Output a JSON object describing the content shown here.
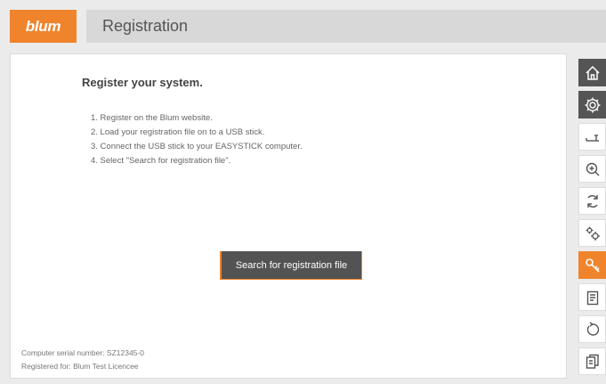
{
  "header": {
    "logo": "blum",
    "title": "Registration"
  },
  "main": {
    "heading": "Register your system.",
    "steps": [
      "1. Register on the Blum website.",
      "2. Load your registration file on to a USB stick.",
      "3. Connect the USB stick to your EASYSTICK computer.",
      "4. Select \"Search for registration file\"."
    ],
    "button_label": "Search for registration file",
    "footer": {
      "serial": "Computer serial number: SZ12345-0",
      "registered": "Registered for: Blum Test Licencee"
    }
  },
  "sidebar": {
    "items": [
      {
        "icon": "home-icon",
        "style": "dark"
      },
      {
        "icon": "settings-icon",
        "style": "dark"
      },
      {
        "icon": "drill-icon",
        "style": "light"
      },
      {
        "icon": "zoom-icon",
        "style": "light"
      },
      {
        "icon": "sync-icon",
        "style": "light"
      },
      {
        "icon": "gears-icon",
        "style": "light"
      },
      {
        "icon": "key-icon",
        "style": "active"
      },
      {
        "icon": "clipboard-icon",
        "style": "light"
      },
      {
        "icon": "reset-icon",
        "style": "light"
      },
      {
        "icon": "documents-icon",
        "style": "light"
      }
    ]
  },
  "colors": {
    "accent": "#f0842c",
    "dark_button": "#535353",
    "header_bar": "#d8d8d8"
  }
}
